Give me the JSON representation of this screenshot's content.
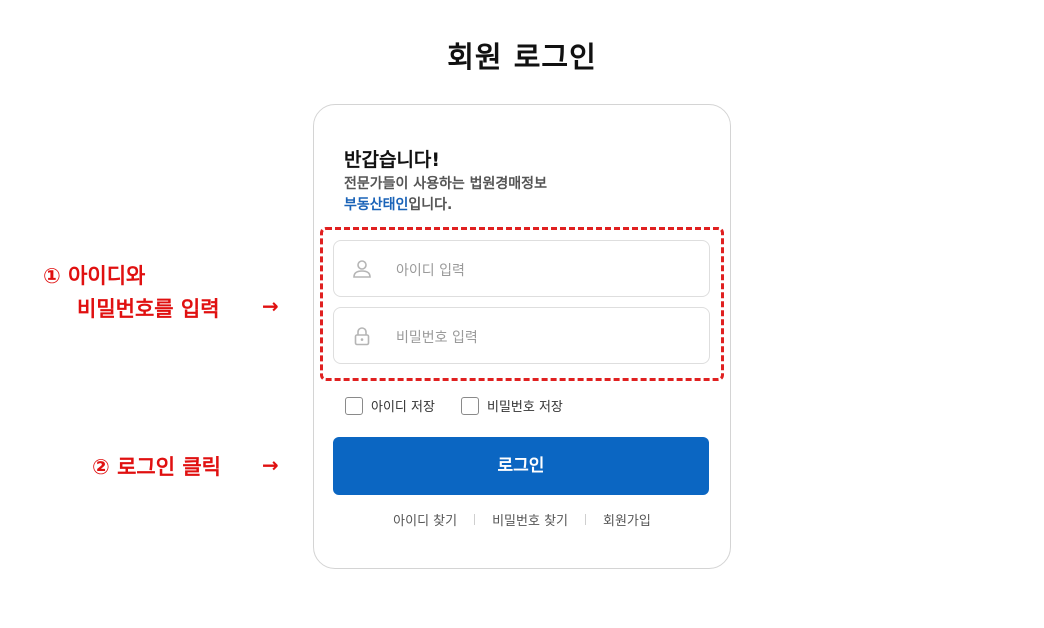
{
  "page": {
    "title": "회원 로그인"
  },
  "card": {
    "welcome_title": "반갑습니다!",
    "welcome_line1": "전문가들이 사용하는 법원경매정보",
    "welcome_brand": "부동산태인",
    "welcome_suffix": "입니다.",
    "id_field": {
      "placeholder": "아이디 입력",
      "value": "",
      "icon": "user-icon"
    },
    "pw_field": {
      "placeholder": "비밀번호 입력",
      "value": "",
      "icon": "lock-icon"
    },
    "save_id_label": "아이디 저장",
    "save_pw_label": "비밀번호 저장",
    "save_id_checked": false,
    "save_pw_checked": false,
    "login_label": "로그인",
    "links": [
      "아이디 찾기",
      "비밀번호 찾기",
      "회원가입"
    ]
  },
  "annotations": {
    "step1_line1": "① 아이디와",
    "step1_line2": "비밀번호를 입력",
    "step2": "② 로그인 클릭",
    "arrow": "→"
  },
  "colors": {
    "brand": "#1a63b8",
    "primary_button": "#0b66c2",
    "annotation": "#e01010"
  }
}
